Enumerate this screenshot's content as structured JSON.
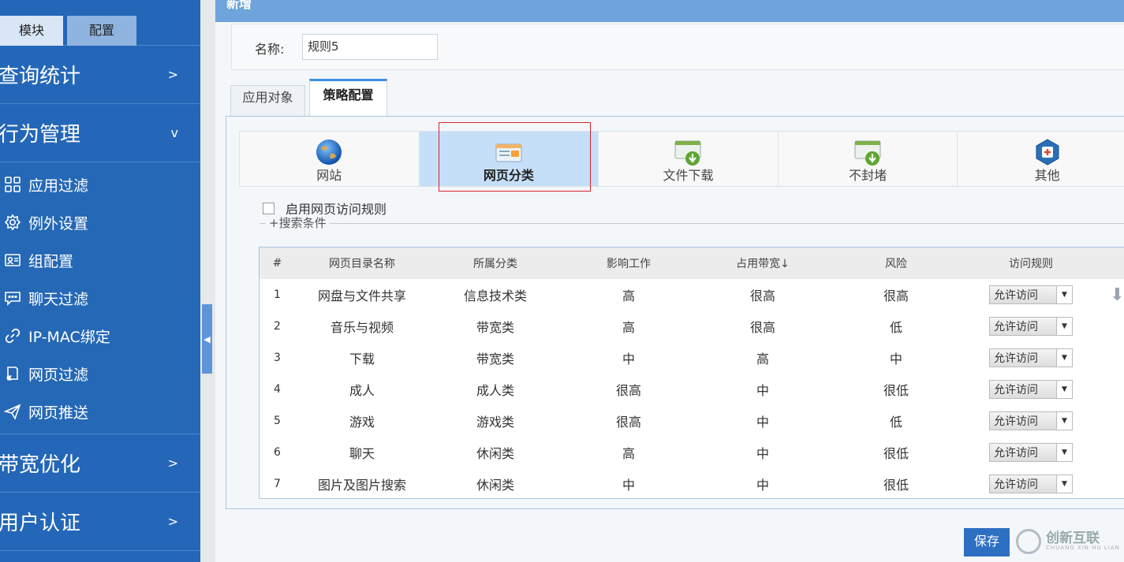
{
  "sidebar": {
    "tabs": {
      "module": "模块",
      "config": "配置"
    },
    "sections": [
      {
        "label": "查询统计",
        "chevron": ">"
      },
      {
        "label": "行为管理",
        "chevron": "v"
      },
      {
        "label": "带宽优化",
        "chevron": ">"
      },
      {
        "label": "用户认证",
        "chevron": ">"
      }
    ],
    "items": [
      {
        "label": "应用过滤",
        "icon": "grid-icon"
      },
      {
        "label": "例外设置",
        "icon": "gear-icon"
      },
      {
        "label": "组配置",
        "icon": "id-card-icon"
      },
      {
        "label": "聊天过滤",
        "icon": "chat-icon"
      },
      {
        "label": "IP-MAC绑定",
        "icon": "link-icon"
      },
      {
        "label": "网页过滤",
        "icon": "page-icon"
      },
      {
        "label": "网页推送",
        "icon": "send-icon"
      }
    ]
  },
  "main": {
    "title": "新增",
    "name_label": "名称:",
    "name_value": "规则5",
    "tabs": [
      "应用对象",
      "策略配置"
    ],
    "categories": [
      {
        "label": "网站",
        "icon": "globe-icon"
      },
      {
        "label": "网页分类",
        "icon": "webpage-category-icon"
      },
      {
        "label": "文件下载",
        "icon": "file-download-icon"
      },
      {
        "label": "不封堵",
        "icon": "no-block-icon"
      },
      {
        "label": "其他",
        "icon": "other-icon"
      }
    ],
    "enable_label": "启用网页访问规则",
    "search_label": "+搜索条件",
    "save_label": "保存"
  },
  "table": {
    "headers": [
      "#",
      "网页目录名称",
      "所属分类",
      "影响工作",
      "占用带宽↓",
      "风险",
      "访问规则"
    ],
    "rows": [
      [
        "1",
        "网盘与文件共享",
        "信息技术类",
        "高",
        "很高",
        "很高",
        "允许访问"
      ],
      [
        "2",
        "音乐与视频",
        "带宽类",
        "高",
        "很高",
        "低",
        "允许访问"
      ],
      [
        "3",
        "下载",
        "带宽类",
        "中",
        "高",
        "中",
        "允许访问"
      ],
      [
        "4",
        "成人",
        "成人类",
        "很高",
        "中",
        "很低",
        "允许访问"
      ],
      [
        "5",
        "游戏",
        "游戏类",
        "很高",
        "中",
        "低",
        "允许访问"
      ],
      [
        "6",
        "聊天",
        "休闲类",
        "高",
        "中",
        "很低",
        "允许访问"
      ],
      [
        "7",
        "图片及图片搜索",
        "休闲类",
        "中",
        "中",
        "很低",
        "允许访问"
      ]
    ]
  },
  "watermark": {
    "text": "创新互联",
    "sub": "CHUANG XIN HU LIAN"
  }
}
